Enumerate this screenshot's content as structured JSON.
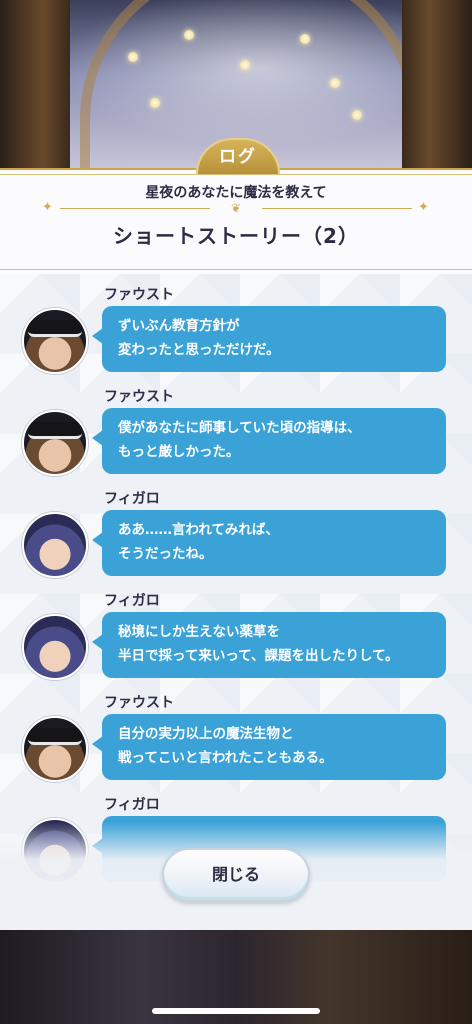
{
  "header": {
    "tab_label": "ログ",
    "subtitle": "星夜のあなたに魔法を教えて",
    "title": "ショートストーリー（2）"
  },
  "log": [
    {
      "speaker": "ファウスト",
      "lines": [
        "ずいぶん教育方針が",
        "変わったと思っただけだ。"
      ]
    },
    {
      "speaker": "ファウスト",
      "lines": [
        "僕があなたに師事していた頃の指導は、",
        "もっと厳しかった。"
      ]
    },
    {
      "speaker": "フィガロ",
      "lines": [
        "ああ……言われてみれば、",
        "そうだったね。"
      ]
    },
    {
      "speaker": "フィガロ",
      "lines": [
        "秘境にしか生えない薬草を",
        "半日で採って来いって、課題を出したりして。"
      ]
    },
    {
      "speaker": "ファウスト",
      "lines": [
        "自分の実力以上の魔法生物と",
        "戦ってこいと言われたこともある。"
      ]
    },
    {
      "speaker": "フィガロ",
      "lines": [
        "",
        ""
      ]
    }
  ],
  "buttons": {
    "close_label": "閉じる"
  },
  "colors": {
    "bubble": "#3ba2d8",
    "gold": "#c9a64a"
  }
}
